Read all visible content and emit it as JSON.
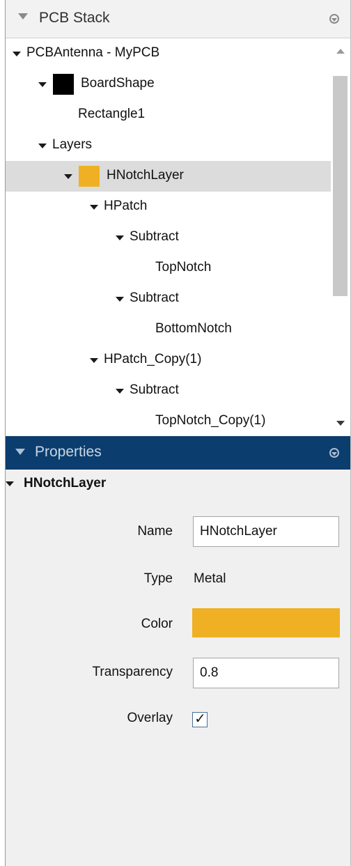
{
  "stack_panel": {
    "title": "PCB Stack",
    "tree": [
      {
        "label": "PCBAntenna - MyPCB",
        "depth": 0,
        "expanded": true
      },
      {
        "label": "BoardShape",
        "depth": 1,
        "expanded": true,
        "swatch_color": "#000000"
      },
      {
        "label": "Rectangle1",
        "depth": 2,
        "expanded": null
      },
      {
        "label": "Layers",
        "depth": 1,
        "expanded": true
      },
      {
        "label": "HNotchLayer",
        "depth": 2,
        "expanded": true,
        "swatch_color": "#efb123",
        "selected": true
      },
      {
        "label": "HPatch",
        "depth": 3,
        "expanded": true
      },
      {
        "label": "Subtract",
        "depth": 4,
        "expanded": true
      },
      {
        "label": "TopNotch",
        "depth": 5,
        "expanded": null
      },
      {
        "label": "Subtract",
        "depth": 4,
        "expanded": true
      },
      {
        "label": "BottomNotch",
        "depth": 5,
        "expanded": null
      },
      {
        "label": "HPatch_Copy(1)",
        "depth": 3,
        "expanded": true
      },
      {
        "label": "Subtract",
        "depth": 4,
        "expanded": true
      },
      {
        "label": "TopNotch_Copy(1)",
        "depth": 5,
        "expanded": null
      }
    ]
  },
  "properties_panel": {
    "title": "Properties",
    "section_title": "HNotchLayer",
    "fields": {
      "name": {
        "label": "Name",
        "value": "HNotchLayer"
      },
      "type": {
        "label": "Type",
        "value": "Metal"
      },
      "color": {
        "label": "Color",
        "value": "#efb123"
      },
      "transparency": {
        "label": "Transparency",
        "value": "0.8"
      },
      "overlay": {
        "label": "Overlay",
        "checked": true
      }
    }
  },
  "icons": {
    "panel_menu": "settings-circle-icon",
    "expand": "triangle-down-icon",
    "check": "checkmark-icon"
  }
}
